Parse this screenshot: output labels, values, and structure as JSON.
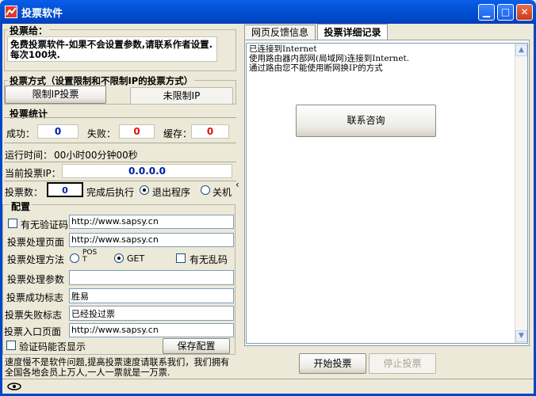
{
  "window": {
    "title": "投票软件"
  },
  "notice": {
    "group_title": "投票给：",
    "text": "免费投票软件-如果不会设置参数,请联系作者设置.每次100块."
  },
  "mode": {
    "group_title": "投票方式（设置限制和不限制IP的投票方式）",
    "limit_ip_button": "限制IP投票",
    "no_limit_ip_button": "未限制IP"
  },
  "stats": {
    "group_title": "投票统计",
    "success_label": "成功：",
    "success_value": "0",
    "fail_label": "失败：",
    "fail_value": "0",
    "cache_label": "缓存：",
    "cache_value": "0",
    "runtime_label": "运行时间：",
    "runtime_value": "00小时00分钟00秒",
    "current_ip_label": "当前投票IP：",
    "current_ip_value": "0.0.0.0",
    "vote_count_label": "投票数：",
    "vote_count_value": "0",
    "after_done_label": "完成后执行",
    "exit_program_label": "退出程序",
    "shutdown_label": "关机"
  },
  "config": {
    "group_title": "配置",
    "captcha_label": "有无验证码",
    "captcha_url": "http://www.sapsy.cn",
    "handler_page_label": "投票处理页面",
    "handler_page_value": "http://www.sapsy.cn",
    "method_label": "投票处理方法",
    "post_label": "POST",
    "get_label": "GET",
    "garbled_label": "有无乱码",
    "params_label": "投票处理参数",
    "params_value": "",
    "success_flag_label": "投票成功标志",
    "success_flag_value": "胜易",
    "fail_flag_label": "投票失败标志",
    "fail_flag_value": "已经投过票",
    "entry_page_label": "投票入口页面",
    "entry_page_value": "http://www.sapsy.cn",
    "captcha_display_label": "验证码能否显示",
    "save_button": "保存配置"
  },
  "footer": {
    "text": "速度慢不是软件问题,提高投票速度请联系我们，我们拥有全国各地会员上万人,一人一票就是一万票."
  },
  "tabs": [
    {
      "label": "网页反馈信息"
    },
    {
      "label": "投票详细记录"
    }
  ],
  "log": {
    "lines": [
      "已连接到Internet",
      "使用路由器内部网(局域网)连接到Internet.",
      "通过路由您不能使用断网换IP的方式"
    ],
    "contact_button": "联系咨询"
  },
  "actions": {
    "start_button": "开始投票",
    "stop_button": "停止投票"
  },
  "colors": {
    "titlebar": "#0046c6",
    "window_bg": "#ece9d8",
    "count_red": "#e01010",
    "ip_blue": "#0020a0"
  }
}
